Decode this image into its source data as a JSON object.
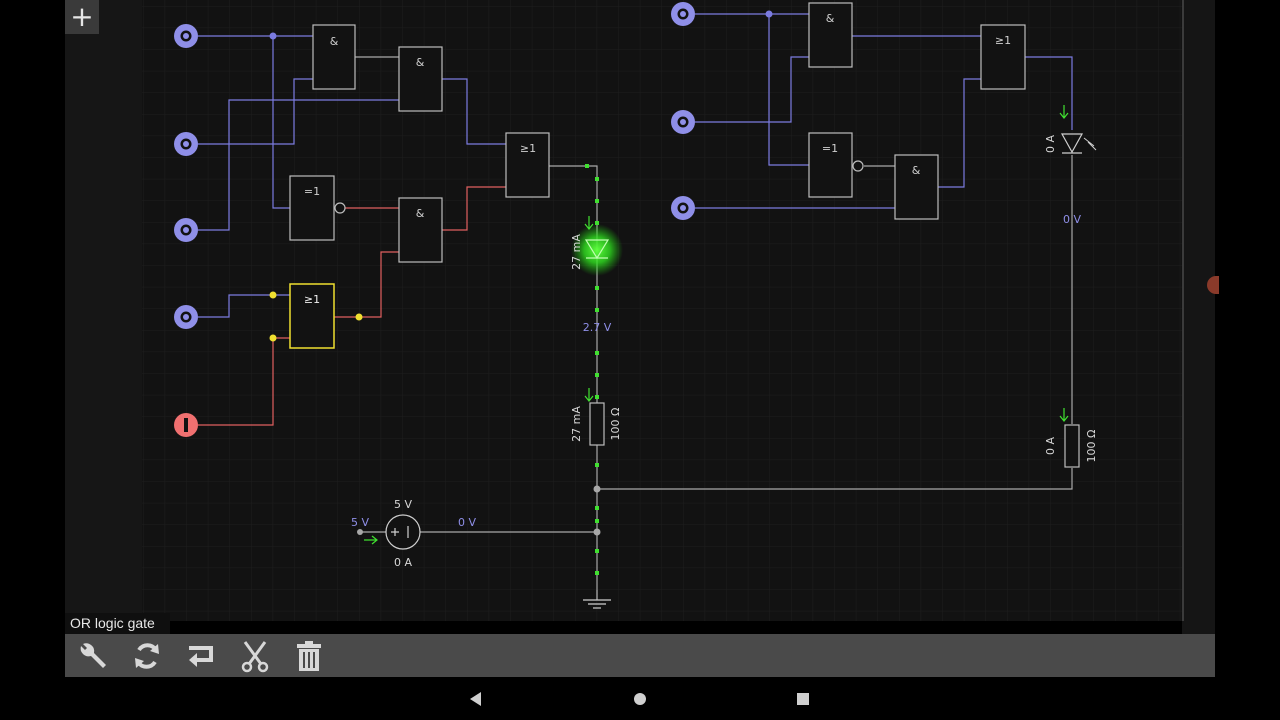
{
  "status_bar": {
    "selected_component": "OR logic gate"
  },
  "toolbar": {
    "buttons": [
      {
        "name": "properties",
        "icon": "wrench-icon"
      },
      {
        "name": "rotate",
        "icon": "rotate-icon"
      },
      {
        "name": "mirror",
        "icon": "mirror-icon"
      },
      {
        "name": "cut-wires",
        "icon": "scissors-icon"
      },
      {
        "name": "delete",
        "icon": "trash-icon"
      }
    ]
  },
  "add_button": {
    "label": "+"
  },
  "circuit": {
    "gates": {
      "and_gate_label": "&",
      "or_gate_label": "≥1",
      "xor_gate_label": "=1"
    },
    "readouts": {
      "led1_current": "27 mA",
      "node_voltage": "2.7 V",
      "r1_current": "27 mA",
      "r1_value": "100 Ω",
      "led2_current": "0 A",
      "led2_node_voltage": "0 V",
      "r2_current": "0 A",
      "r2_value": "100 Ω",
      "source_voltage_label": "5 V",
      "source_top_label": "5 V",
      "source_current": "0 A",
      "ground_voltage": "0 V"
    },
    "colors": {
      "wire_low": "#7b7be0",
      "wire_high": "#e06060",
      "wire_neutral": "#a8a8a8",
      "selected": "#f0e030",
      "led_on": "#30e020",
      "input_high": "#f07070",
      "input_low": "#8f8fe8"
    }
  }
}
